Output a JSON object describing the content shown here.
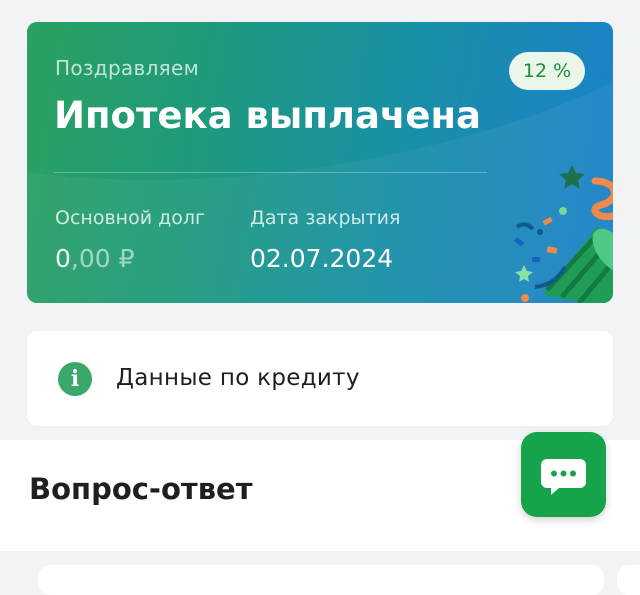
{
  "card": {
    "congrats": "Поздравляем",
    "title": "Ипотека выплачена",
    "rate_badge": "12 %",
    "debt_label": "Основной долг",
    "debt_int": "0",
    "debt_dec": ",00",
    "debt_currency": " ₽",
    "close_date_label": "Дата закрытия",
    "close_date_value": "02.07.2024"
  },
  "info": {
    "label": "Данные по кредиту",
    "icon": "info-icon"
  },
  "faq": {
    "title": "Вопрос-ответ"
  },
  "fab": {
    "icon": "chat-icon"
  },
  "colors": {
    "brand_green": "#16a34a",
    "card_start": "#2aa160",
    "card_end": "#1c80cc"
  }
}
